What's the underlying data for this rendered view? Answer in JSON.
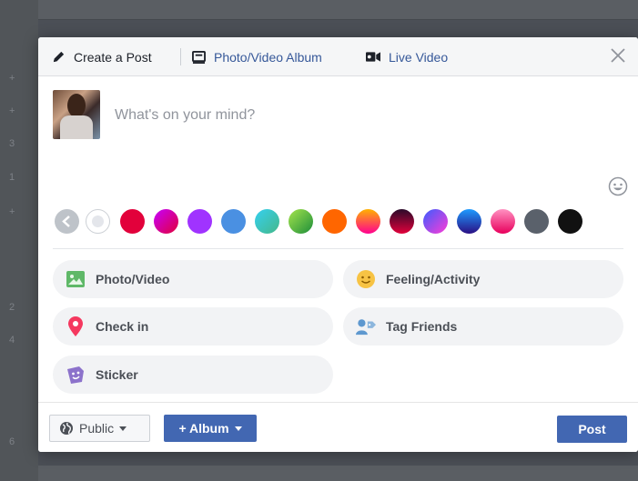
{
  "background": {
    "side_numbers": [
      "+",
      "+",
      "3",
      "1",
      "+",
      "2",
      "4",
      "6"
    ]
  },
  "header": {
    "tabs": [
      {
        "label": "Create a Post",
        "icon": "pencil-icon"
      },
      {
        "label": "Photo/Video Album",
        "icon": "album-icon"
      },
      {
        "label": "Live Video",
        "icon": "video-camera-icon"
      }
    ],
    "close_icon": "close-icon"
  },
  "composer": {
    "placeholder": "What's on your mind?",
    "emoji_icon": "smiley-icon"
  },
  "colors": {
    "swatches": [
      "#e4e6eb-back",
      "#ffffff",
      "#e2013b",
      "gradient-purple-red",
      "#a033ff",
      "#4a90e2",
      "gradient-teal",
      "gradient-green",
      "#ff6600",
      "gradient-orange-pink",
      "gradient-dark-red",
      "gradient-blue-pink",
      "gradient-blue",
      "gradient-pink",
      "#5a616b",
      "#111111"
    ]
  },
  "actions": [
    {
      "label": "Photo/Video",
      "icon": "photo-icon"
    },
    {
      "label": "Feeling/Activity",
      "icon": "smiley-face-icon"
    },
    {
      "label": "Check in",
      "icon": "location-pin-icon"
    },
    {
      "label": "Tag Friends",
      "icon": "tag-friends-icon"
    },
    {
      "label": "Sticker",
      "icon": "sticker-icon"
    }
  ],
  "footer": {
    "privacy_label": "Public",
    "album_label": "+ Album",
    "post_label": "Post"
  },
  "accent": {
    "brand_blue": "#4267b2",
    "link_blue": "#365899"
  }
}
